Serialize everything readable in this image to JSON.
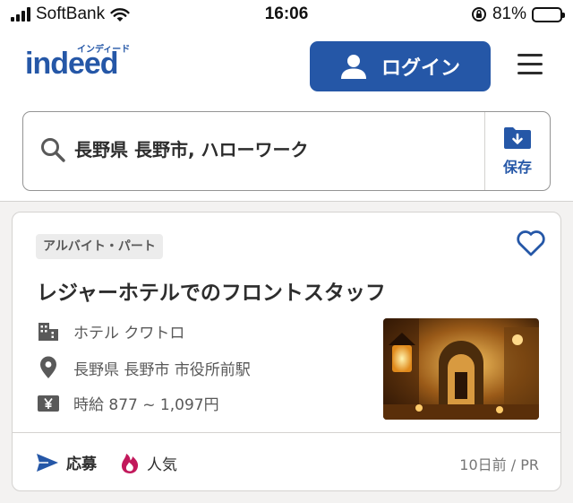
{
  "status_bar": {
    "carrier": "SoftBank",
    "time": "16:06",
    "battery": "81%",
    "battery_level": 0.81
  },
  "header": {
    "logo_text": "indeed",
    "logo_kana": "インディード",
    "login_label": "ログイン",
    "menu_icon": "hamburger-icon"
  },
  "search": {
    "query": "長野県 長野市, ハローワーク",
    "save_label": "保存"
  },
  "job": {
    "badge": "アルバイト・パート",
    "title": "レジャーホテルでのフロントスタッフ",
    "company": "ホテル クワトロ",
    "location": "長野県 長野市 市役所前駅",
    "salary": "時給 877 ~ 1,097円",
    "apply_label": "応募",
    "popular_label": "人気",
    "posted": "10日前 / PR"
  },
  "colors": {
    "brand_blue": "#2557a7",
    "popular_pink": "#c2185b"
  }
}
